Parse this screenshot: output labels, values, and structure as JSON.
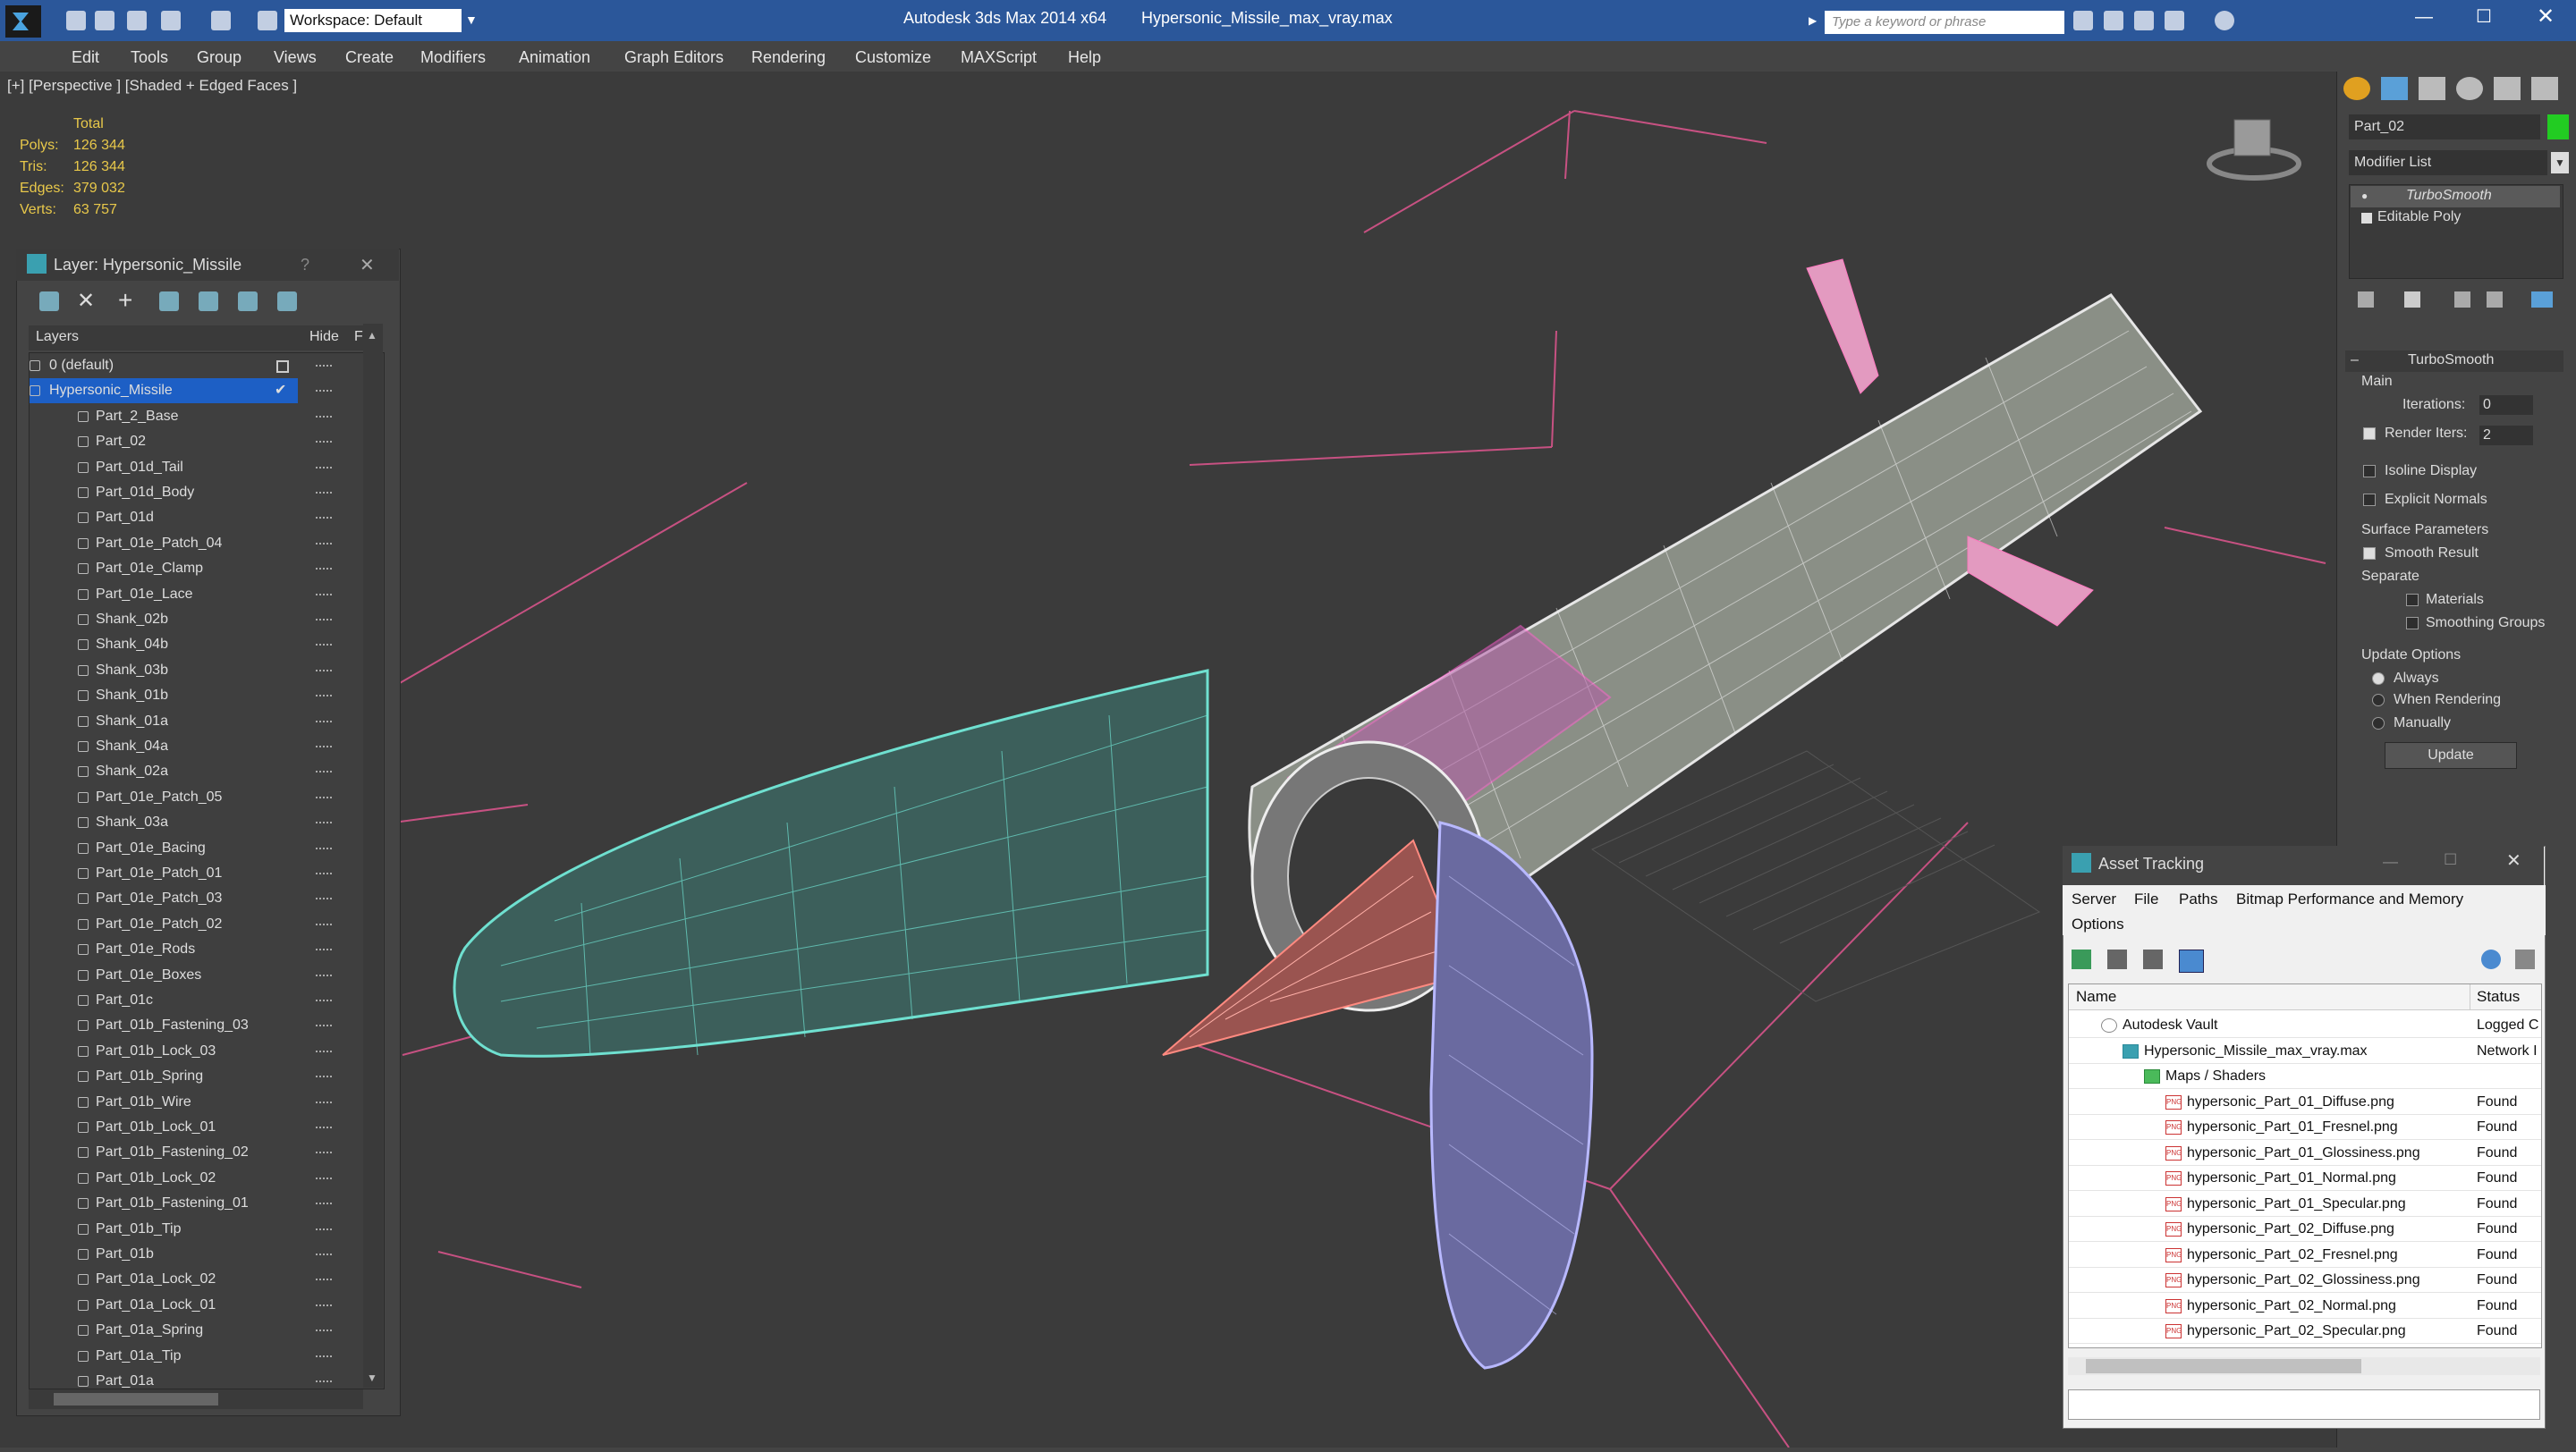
{
  "app": {
    "title": "Autodesk 3ds Max  2014 x64",
    "file": "Hypersonic_Missile_max_vray.max",
    "workspace": "Workspace: Default",
    "search_placeholder": "Type a keyword or phrase"
  },
  "menu": [
    "Edit",
    "Tools",
    "Group",
    "Views",
    "Create",
    "Modifiers",
    "Animation",
    "Graph Editors",
    "Rendering",
    "Customize",
    "MAXScript",
    "Help"
  ],
  "viewport": {
    "label": "[+] [Perspective ] [Shaded + Edged Faces ]",
    "stats_total": "Total",
    "stats": [
      {
        "k": "Polys:",
        "v": "126 344"
      },
      {
        "k": "Tris:",
        "v": "126 344"
      },
      {
        "k": "Edges:",
        "v": "379 032"
      },
      {
        "k": "Verts:",
        "v": "63 757"
      }
    ]
  },
  "layer_panel": {
    "title": "Layer: Hypersonic_Missile",
    "col_layers": "Layers",
    "col_hide": "Hide",
    "col_f": "F",
    "rows": [
      "0 (default)",
      "Hypersonic_Missile",
      "Part_2_Base",
      "Part_02",
      "Part_01d_Tail",
      "Part_01d_Body",
      "Part_01d",
      "Part_01e_Patch_04",
      "Part_01e_Clamp",
      "Part_01e_Lace",
      "Shank_02b",
      "Shank_04b",
      "Shank_03b",
      "Shank_01b",
      "Shank_01a",
      "Shank_04a",
      "Shank_02a",
      "Part_01e_Patch_05",
      "Shank_03a",
      "Part_01e_Bacing",
      "Part_01e_Patch_01",
      "Part_01e_Patch_03",
      "Part_01e_Patch_02",
      "Part_01e_Rods",
      "Part_01e_Boxes",
      "Part_01c",
      "Part_01b_Fastening_03",
      "Part_01b_Lock_03",
      "Part_01b_Spring",
      "Part_01b_Wire",
      "Part_01b_Lock_01",
      "Part_01b_Fastening_02",
      "Part_01b_Lock_02",
      "Part_01b_Fastening_01",
      "Part_01b_Tip",
      "Part_01b",
      "Part_01a_Lock_02",
      "Part_01a_Lock_01",
      "Part_01a_Spring",
      "Part_01a_Tip",
      "Part_01a"
    ]
  },
  "command_panel": {
    "object_name": "Part_02",
    "object_color": "#22cc22",
    "modifier_list": "Modifier List",
    "stack": [
      "TurboSmooth",
      "Editable Poly"
    ],
    "rollout": "TurboSmooth",
    "main": "Main",
    "iterations_label": "Iterations:",
    "iterations": "0",
    "render_iters_label": "Render Iters:",
    "render_iters": "2",
    "isoline": "Isoline Display",
    "explicit_normals": "Explicit Normals",
    "surface_params": "Surface Parameters",
    "smooth_result": "Smooth Result",
    "separate": "Separate",
    "materials": "Materials",
    "smoothing_groups": "Smoothing Groups",
    "update_options": "Update Options",
    "always": "Always",
    "when_rendering": "When Rendering",
    "manually": "Manually",
    "update": "Update"
  },
  "asset_tracking": {
    "title": "Asset Tracking",
    "menu": [
      "Server",
      "File",
      "Paths",
      "Bitmap Performance and Memory"
    ],
    "options": "Options",
    "col_name": "Name",
    "col_status": "Status",
    "rows": [
      {
        "name": "Autodesk Vault",
        "status": "Logged C",
        "indent": 1
      },
      {
        "name": "Hypersonic_Missile_max_vray.max",
        "status": "Network I",
        "indent": 2
      },
      {
        "name": "Maps / Shaders",
        "status": "",
        "indent": 3
      },
      {
        "name": "hypersonic_Part_01_Diffuse.png",
        "status": "Found",
        "indent": 4
      },
      {
        "name": "hypersonic_Part_01_Fresnel.png",
        "status": "Found",
        "indent": 4
      },
      {
        "name": "hypersonic_Part_01_Glossiness.png",
        "status": "Found",
        "indent": 4
      },
      {
        "name": "hypersonic_Part_01_Normal.png",
        "status": "Found",
        "indent": 4
      },
      {
        "name": "hypersonic_Part_01_Specular.png",
        "status": "Found",
        "indent": 4
      },
      {
        "name": "hypersonic_Part_02_Diffuse.png",
        "status": "Found",
        "indent": 4
      },
      {
        "name": "hypersonic_Part_02_Fresnel.png",
        "status": "Found",
        "indent": 4
      },
      {
        "name": "hypersonic_Part_02_Glossiness.png",
        "status": "Found",
        "indent": 4
      },
      {
        "name": "hypersonic_Part_02_Normal.png",
        "status": "Found",
        "indent": 4
      },
      {
        "name": "hypersonic_Part_02_Specular.png",
        "status": "Found",
        "indent": 4
      }
    ]
  }
}
